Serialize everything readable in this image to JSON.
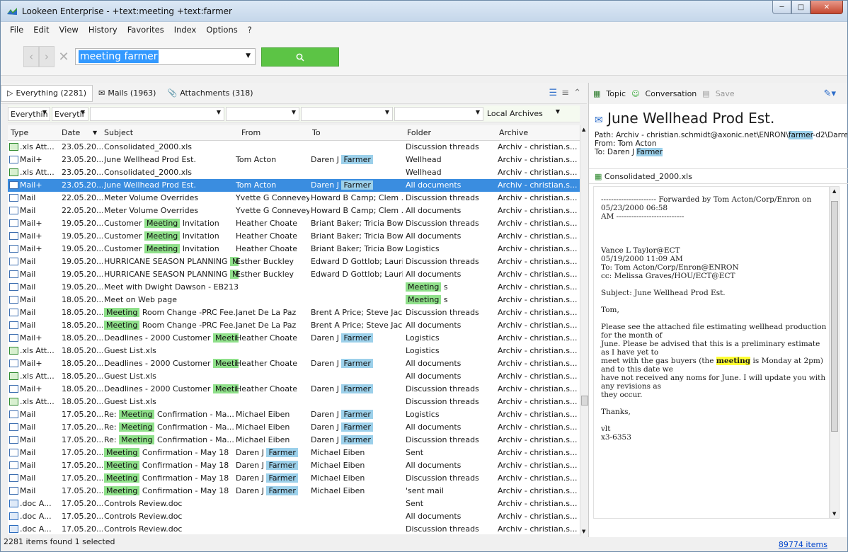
{
  "window": {
    "title": "Lookeen Enterprise - +text:meeting +text:farmer"
  },
  "menu": [
    "File",
    "Edit",
    "View",
    "History",
    "Favorites",
    "Index",
    "Options",
    "?"
  ],
  "search": {
    "query": "meeting farmer"
  },
  "tabs": [
    {
      "label": "Everything (2281)"
    },
    {
      "label": "Mails (1963)"
    },
    {
      "label": "Attachments (318)"
    }
  ],
  "filters": {
    "f1": "Everythin",
    "f2": "Everytir",
    "archives": "Local Archives"
  },
  "columns": [
    "Type",
    "Date",
    "Subject",
    "From",
    "To",
    "Folder",
    "Archive"
  ],
  "rows": [
    {
      "type": ".xls Att...",
      "icon": "xls",
      "date": "23.05.20...",
      "subject": [
        {
          "t": "Consolidated_2000.xls"
        }
      ],
      "from": [],
      "to": [],
      "folder": [
        {
          "t": "Discussion threads"
        }
      ],
      "archive": "Archiv - christian.s..."
    },
    {
      "type": "Mail+",
      "icon": "mailplus",
      "date": "23.05.20...",
      "subject": [
        {
          "t": "June Wellhead Prod Est."
        }
      ],
      "from": [
        {
          "t": "Tom Acton"
        }
      ],
      "to": [
        {
          "t": "Daren J "
        },
        {
          "t": "Farmer",
          "hl": "b"
        }
      ],
      "folder": [
        {
          "t": "Wellhead"
        }
      ],
      "archive": "Archiv - christian.s..."
    },
    {
      "type": ".xls Att...",
      "icon": "xls",
      "date": "23.05.20...",
      "subject": [
        {
          "t": "Consolidated_2000.xls"
        }
      ],
      "from": [],
      "to": [],
      "folder": [
        {
          "t": "Wellhead"
        }
      ],
      "archive": "Archiv - christian.s..."
    },
    {
      "type": "Mail+",
      "icon": "mailplus",
      "selected": true,
      "date": "23.05.20...",
      "subject": [
        {
          "t": "June Wellhead Prod Est."
        }
      ],
      "from": [
        {
          "t": "Tom Acton"
        }
      ],
      "to": [
        {
          "t": "Daren J "
        },
        {
          "t": "Farmer",
          "hl": "b"
        }
      ],
      "folder": [
        {
          "t": "All documents"
        }
      ],
      "archive": "Archiv - christian.s..."
    },
    {
      "type": "Mail",
      "icon": "mail",
      "date": "22.05.20...",
      "subject": [
        {
          "t": "Meter Volume Overrides"
        }
      ],
      "from": [
        {
          "t": "Yvette G Connevey"
        }
      ],
      "to": [
        {
          "t": "Howard B Camp; Clem ..."
        }
      ],
      "folder": [
        {
          "t": "Discussion threads"
        }
      ],
      "archive": "Archiv - christian.s..."
    },
    {
      "type": "Mail",
      "icon": "mail",
      "date": "22.05.20...",
      "subject": [
        {
          "t": "Meter Volume Overrides"
        }
      ],
      "from": [
        {
          "t": "Yvette G Connevey"
        }
      ],
      "to": [
        {
          "t": "Howard B Camp; Clem ..."
        }
      ],
      "folder": [
        {
          "t": "All documents"
        }
      ],
      "archive": "Archiv - christian.s..."
    },
    {
      "type": "Mail+",
      "icon": "mailplus",
      "date": "19.05.20...",
      "subject": [
        {
          "t": "Customer "
        },
        {
          "t": "Meeting",
          "hl": "g"
        },
        {
          "t": " Invitation"
        }
      ],
      "from": [
        {
          "t": "Heather Choate"
        }
      ],
      "to": [
        {
          "t": "Briant Baker; Tricia Bow..."
        }
      ],
      "folder": [
        {
          "t": "Discussion threads"
        }
      ],
      "archive": "Archiv - christian.s..."
    },
    {
      "type": "Mail+",
      "icon": "mailplus",
      "date": "19.05.20...",
      "subject": [
        {
          "t": "Customer "
        },
        {
          "t": "Meeting",
          "hl": "g"
        },
        {
          "t": " Invitation"
        }
      ],
      "from": [
        {
          "t": "Heather Choate"
        }
      ],
      "to": [
        {
          "t": "Briant Baker; Tricia Bow..."
        }
      ],
      "folder": [
        {
          "t": "All documents"
        }
      ],
      "archive": "Archiv - christian.s..."
    },
    {
      "type": "Mail+",
      "icon": "mailplus",
      "date": "19.05.20...",
      "subject": [
        {
          "t": "Customer "
        },
        {
          "t": "Meeting",
          "hl": "g"
        },
        {
          "t": " Invitation"
        }
      ],
      "from": [
        {
          "t": "Heather Choate"
        }
      ],
      "to": [
        {
          "t": "Briant Baker; Tricia Bow..."
        }
      ],
      "folder": [
        {
          "t": "Logistics"
        }
      ],
      "archive": "Archiv - christian.s..."
    },
    {
      "type": "Mail",
      "icon": "mail",
      "date": "19.05.20...",
      "subject": [
        {
          "t": "HURRICANE SEASON PLANNING "
        },
        {
          "t": "M.",
          "hl": "g"
        }
      ],
      "from": [
        {
          "t": "Esther Buckley"
        }
      ],
      "to": [
        {
          "t": "Edward D Gottlob; Lauri..."
        }
      ],
      "folder": [
        {
          "t": "Discussion threads"
        }
      ],
      "archive": "Archiv - christian.s..."
    },
    {
      "type": "Mail",
      "icon": "mail",
      "date": "19.05.20...",
      "subject": [
        {
          "t": "HURRICANE SEASON PLANNING "
        },
        {
          "t": "M.",
          "hl": "g"
        }
      ],
      "from": [
        {
          "t": "Esther Buckley"
        }
      ],
      "to": [
        {
          "t": "Edward D Gottlob; Lauri..."
        }
      ],
      "folder": [
        {
          "t": "All documents"
        }
      ],
      "archive": "Archiv - christian.s..."
    },
    {
      "type": "Mail",
      "icon": "mail",
      "date": "19.05.20...",
      "subject": [
        {
          "t": "Meet with Dwight Dawson  - EB2133"
        }
      ],
      "from": [],
      "to": [],
      "folder": [
        {
          "t": "Meeting",
          "hl": "g"
        },
        {
          "t": " s"
        }
      ],
      "archive": "Archiv - christian.s..."
    },
    {
      "type": "Mail",
      "icon": "mail",
      "date": "18.05.20...",
      "subject": [
        {
          "t": "Meet on Web page"
        }
      ],
      "from": [],
      "to": [],
      "folder": [
        {
          "t": "Meeting",
          "hl": "g"
        },
        {
          "t": " s"
        }
      ],
      "archive": "Archiv - christian.s..."
    },
    {
      "type": "Mail",
      "icon": "mail",
      "date": "18.05.20...",
      "subject": [
        {
          "t": "Meeting",
          "hl": "g"
        },
        {
          "t": " Room Change -PRC Fee..."
        }
      ],
      "from": [
        {
          "t": "Janet De La Paz"
        }
      ],
      "to": [
        {
          "t": "Brent A Price; Steve Jac..."
        }
      ],
      "folder": [
        {
          "t": "Discussion threads"
        }
      ],
      "archive": "Archiv - christian.s..."
    },
    {
      "type": "Mail",
      "icon": "mail",
      "date": "18.05.20...",
      "subject": [
        {
          "t": "Meeting",
          "hl": "g"
        },
        {
          "t": " Room Change -PRC Fee..."
        }
      ],
      "from": [
        {
          "t": "Janet De La Paz"
        }
      ],
      "to": [
        {
          "t": "Brent A Price; Steve Jac..."
        }
      ],
      "folder": [
        {
          "t": "All documents"
        }
      ],
      "archive": "Archiv - christian.s..."
    },
    {
      "type": "Mail+",
      "icon": "mailplus",
      "date": "18.05.20...",
      "subject": [
        {
          "t": "Deadlines - 2000 Customer "
        },
        {
          "t": "Meeti...",
          "hl": "g"
        }
      ],
      "from": [
        {
          "t": "Heather Choate"
        }
      ],
      "to": [
        {
          "t": "Daren J "
        },
        {
          "t": "Farmer",
          "hl": "b"
        }
      ],
      "folder": [
        {
          "t": "Logistics"
        }
      ],
      "archive": "Archiv - christian.s..."
    },
    {
      "type": ".xls Att...",
      "icon": "xls",
      "date": "18.05.20...",
      "subject": [
        {
          "t": "Guest List.xls"
        }
      ],
      "from": [],
      "to": [],
      "folder": [
        {
          "t": "Logistics"
        }
      ],
      "archive": "Archiv - christian.s..."
    },
    {
      "type": "Mail+",
      "icon": "mailplus",
      "date": "18.05.20...",
      "subject": [
        {
          "t": "Deadlines - 2000 Customer "
        },
        {
          "t": "Meeti...",
          "hl": "g"
        }
      ],
      "from": [
        {
          "t": "Heather Choate"
        }
      ],
      "to": [
        {
          "t": "Daren J "
        },
        {
          "t": "Farmer",
          "hl": "b"
        }
      ],
      "folder": [
        {
          "t": "All documents"
        }
      ],
      "archive": "Archiv - christian.s..."
    },
    {
      "type": ".xls Att...",
      "icon": "xls",
      "date": "18.05.20...",
      "subject": [
        {
          "t": "Guest List.xls"
        }
      ],
      "from": [],
      "to": [],
      "folder": [
        {
          "t": "All documents"
        }
      ],
      "archive": "Archiv - christian.s..."
    },
    {
      "type": "Mail+",
      "icon": "mailplus",
      "date": "18.05.20...",
      "subject": [
        {
          "t": "Deadlines - 2000 Customer "
        },
        {
          "t": "Meeti...",
          "hl": "g"
        }
      ],
      "from": [
        {
          "t": "Heather Choate"
        }
      ],
      "to": [
        {
          "t": "Daren J "
        },
        {
          "t": "Farmer",
          "hl": "b"
        }
      ],
      "folder": [
        {
          "t": "Discussion threads"
        }
      ],
      "archive": "Archiv - christian.s..."
    },
    {
      "type": ".xls Att...",
      "icon": "xls",
      "date": "18.05.20...",
      "subject": [
        {
          "t": "Guest List.xls"
        }
      ],
      "from": [],
      "to": [],
      "folder": [
        {
          "t": "Discussion threads"
        }
      ],
      "archive": "Archiv - christian.s..."
    },
    {
      "type": "Mail",
      "icon": "mail",
      "date": "17.05.20...",
      "subject": [
        {
          "t": "Re: "
        },
        {
          "t": "Meeting",
          "hl": "g"
        },
        {
          "t": " Confirmation - Ma..."
        }
      ],
      "from": [
        {
          "t": "Michael Eiben"
        }
      ],
      "to": [
        {
          "t": "Daren J "
        },
        {
          "t": "Farmer",
          "hl": "b"
        }
      ],
      "folder": [
        {
          "t": "Logistics"
        }
      ],
      "archive": "Archiv - christian.s..."
    },
    {
      "type": "Mail",
      "icon": "mail",
      "date": "17.05.20...",
      "subject": [
        {
          "t": "Re: "
        },
        {
          "t": "Meeting",
          "hl": "g"
        },
        {
          "t": " Confirmation - Ma..."
        }
      ],
      "from": [
        {
          "t": "Michael Eiben"
        }
      ],
      "to": [
        {
          "t": "Daren J "
        },
        {
          "t": "Farmer",
          "hl": "b"
        }
      ],
      "folder": [
        {
          "t": "All documents"
        }
      ],
      "archive": "Archiv - christian.s..."
    },
    {
      "type": "Mail",
      "icon": "mail",
      "date": "17.05.20...",
      "subject": [
        {
          "t": "Re: "
        },
        {
          "t": "Meeting",
          "hl": "g"
        },
        {
          "t": " Confirmation - Ma..."
        }
      ],
      "from": [
        {
          "t": "Michael Eiben"
        }
      ],
      "to": [
        {
          "t": "Daren J "
        },
        {
          "t": "Farmer",
          "hl": "b"
        }
      ],
      "folder": [
        {
          "t": "Discussion threads"
        }
      ],
      "archive": "Archiv - christian.s..."
    },
    {
      "type": "Mail",
      "icon": "mail",
      "date": "17.05.20...",
      "subject": [
        {
          "t": "Meeting",
          "hl": "g"
        },
        {
          "t": " Confirmation - May 18"
        }
      ],
      "from": [
        {
          "t": "Daren J "
        },
        {
          "t": "Farmer",
          "hl": "b"
        }
      ],
      "to": [
        {
          "t": "Michael Eiben"
        }
      ],
      "folder": [
        {
          "t": "Sent"
        }
      ],
      "archive": "Archiv - christian.s..."
    },
    {
      "type": "Mail",
      "icon": "mail",
      "date": "17.05.20...",
      "subject": [
        {
          "t": "Meeting",
          "hl": "g"
        },
        {
          "t": " Confirmation - May 18"
        }
      ],
      "from": [
        {
          "t": "Daren J "
        },
        {
          "t": "Farmer",
          "hl": "b"
        }
      ],
      "to": [
        {
          "t": "Michael Eiben"
        }
      ],
      "folder": [
        {
          "t": "All documents"
        }
      ],
      "archive": "Archiv - christian.s..."
    },
    {
      "type": "Mail",
      "icon": "mail",
      "date": "17.05.20...",
      "subject": [
        {
          "t": "Meeting",
          "hl": "g"
        },
        {
          "t": " Confirmation - May 18"
        }
      ],
      "from": [
        {
          "t": "Daren J "
        },
        {
          "t": "Farmer",
          "hl": "b"
        }
      ],
      "to": [
        {
          "t": "Michael Eiben"
        }
      ],
      "folder": [
        {
          "t": "Discussion threads"
        }
      ],
      "archive": "Archiv - christian.s..."
    },
    {
      "type": "Mail",
      "icon": "mail",
      "date": "17.05.20...",
      "subject": [
        {
          "t": "Meeting",
          "hl": "g"
        },
        {
          "t": " Confirmation - May 18"
        }
      ],
      "from": [
        {
          "t": "Daren J "
        },
        {
          "t": "Farmer",
          "hl": "b"
        }
      ],
      "to": [
        {
          "t": "Michael Eiben"
        }
      ],
      "folder": [
        {
          "t": "'sent mail"
        }
      ],
      "archive": "Archiv - christian.s..."
    },
    {
      "type": ".doc A...",
      "icon": "doc",
      "date": "17.05.20...",
      "subject": [
        {
          "t": "Controls Review.doc"
        }
      ],
      "from": [],
      "to": [],
      "folder": [
        {
          "t": "Sent"
        }
      ],
      "archive": "Archiv - christian.s..."
    },
    {
      "type": ".doc A...",
      "icon": "doc",
      "date": "17.05.20...",
      "subject": [
        {
          "t": "Controls Review.doc"
        }
      ],
      "from": [],
      "to": [],
      "folder": [
        {
          "t": "All documents"
        }
      ],
      "archive": "Archiv - christian.s..."
    },
    {
      "type": ".doc A...",
      "icon": "doc",
      "date": "17.05.20...",
      "subject": [
        {
          "t": "Controls Review.doc"
        }
      ],
      "from": [],
      "to": [],
      "folder": [
        {
          "t": "Discussion threads"
        }
      ],
      "archive": "Archiv - christian.s..."
    }
  ],
  "status": {
    "found": "2281 items found  1 selected",
    "total": "89774 items"
  },
  "preview": {
    "topic": "Topic",
    "conversation": "Conversation",
    "save": "Save",
    "title": "June Wellhead Prod Est.",
    "path_prefix": "Path: Archiv - christian.schmidt@axonic.net\\ENRON\\",
    "path_hl": "farmer",
    "path_suffix": "-d2\\Darre",
    "from": "From: Tom Acton",
    "to_prefix": "To: Daren J ",
    "to_hl": "Farmer",
    "attachment": "Consolidated_2000.xls",
    "body": {
      "fwd1": "---------------------- Forwarded by Tom Acton/Corp/Enron on",
      "fwd2": "05/23/2000 06:58",
      "fwd3": "AM ---------------------------",
      "h1": "Vance L Taylor@ECT",
      "h2": "05/19/2000 11:09 AM",
      "h3": "To: Tom Acton/Corp/Enron@ENRON",
      "h4": "cc: Melissa Graves/HOU/ECT@ECT",
      "subject": "Subject: June Wellhead Prod Est.",
      "greet": "Tom,",
      "p1": "Please see the attached file estimating wellhead production for the month of",
      "p2": "June.  Please be advised that this is a preliminary estimate as I have yet to",
      "p3a": "meet with the gas buyers (the ",
      "p3hl": "meeting",
      "p3b": " is Monday at 2pm) and to this date we",
      "p4": "have not received any noms for June.  I will update you with any revisions as",
      "p5": "they occur.",
      "thanks": "Thanks,",
      "sig1": "vlt",
      "sig2": "x3-6353"
    }
  }
}
